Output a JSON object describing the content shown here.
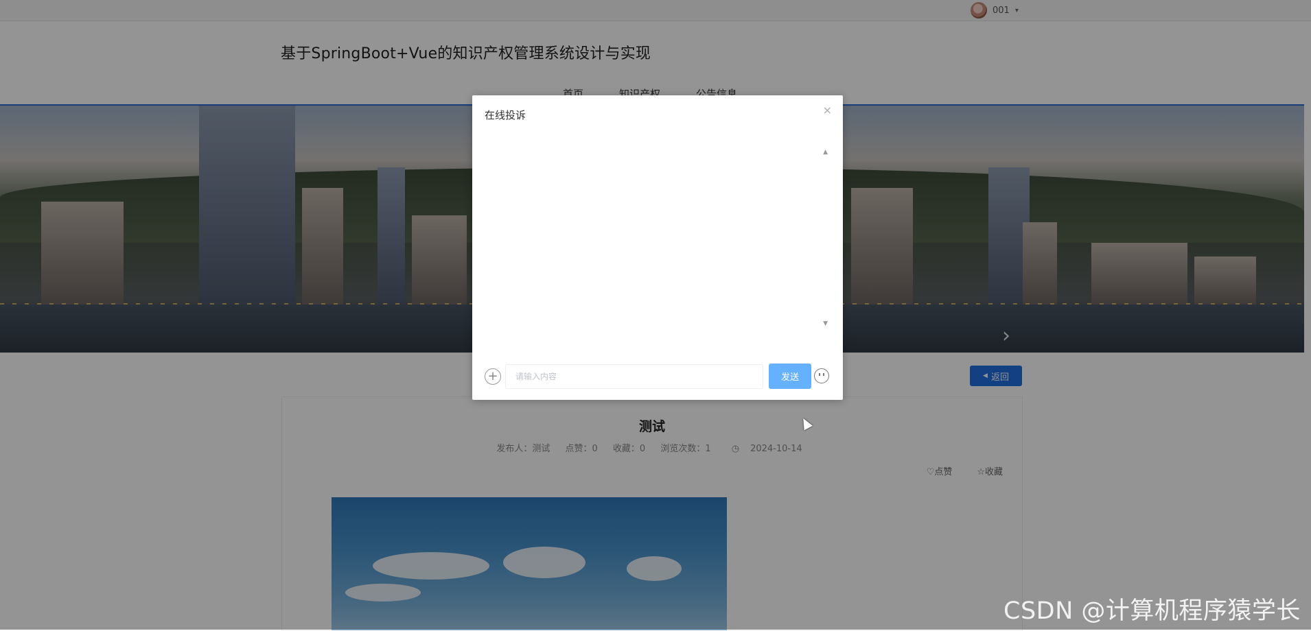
{
  "topbar": {
    "username": "001",
    "caret": "▾"
  },
  "header": {
    "site_title": "基于SpringBoot+Vue的知识产权管理系统设计与实现",
    "nav": [
      {
        "label": "首页"
      },
      {
        "label": "知识产权"
      },
      {
        "label": "公告信息"
      }
    ]
  },
  "banner": {
    "next_arrow": "›"
  },
  "page": {
    "back_label": "返回",
    "back_icon": "◀"
  },
  "article": {
    "title": "测试",
    "publisher": "发布人：测试",
    "likes": "点赞：0",
    "favorites": "收藏：0",
    "views": "浏览次数：1",
    "date": "2024-10-14",
    "like_action": "♡点赞",
    "fav_action": "☆收藏"
  },
  "dialog": {
    "title": "在线投诉",
    "close": "×",
    "input_placeholder": "请输入内容",
    "send_label": "发送",
    "scroll_up": "▲",
    "scroll_down": "▼",
    "plus": "+"
  },
  "watermark": "CSDN @计算机程序猿学长"
}
